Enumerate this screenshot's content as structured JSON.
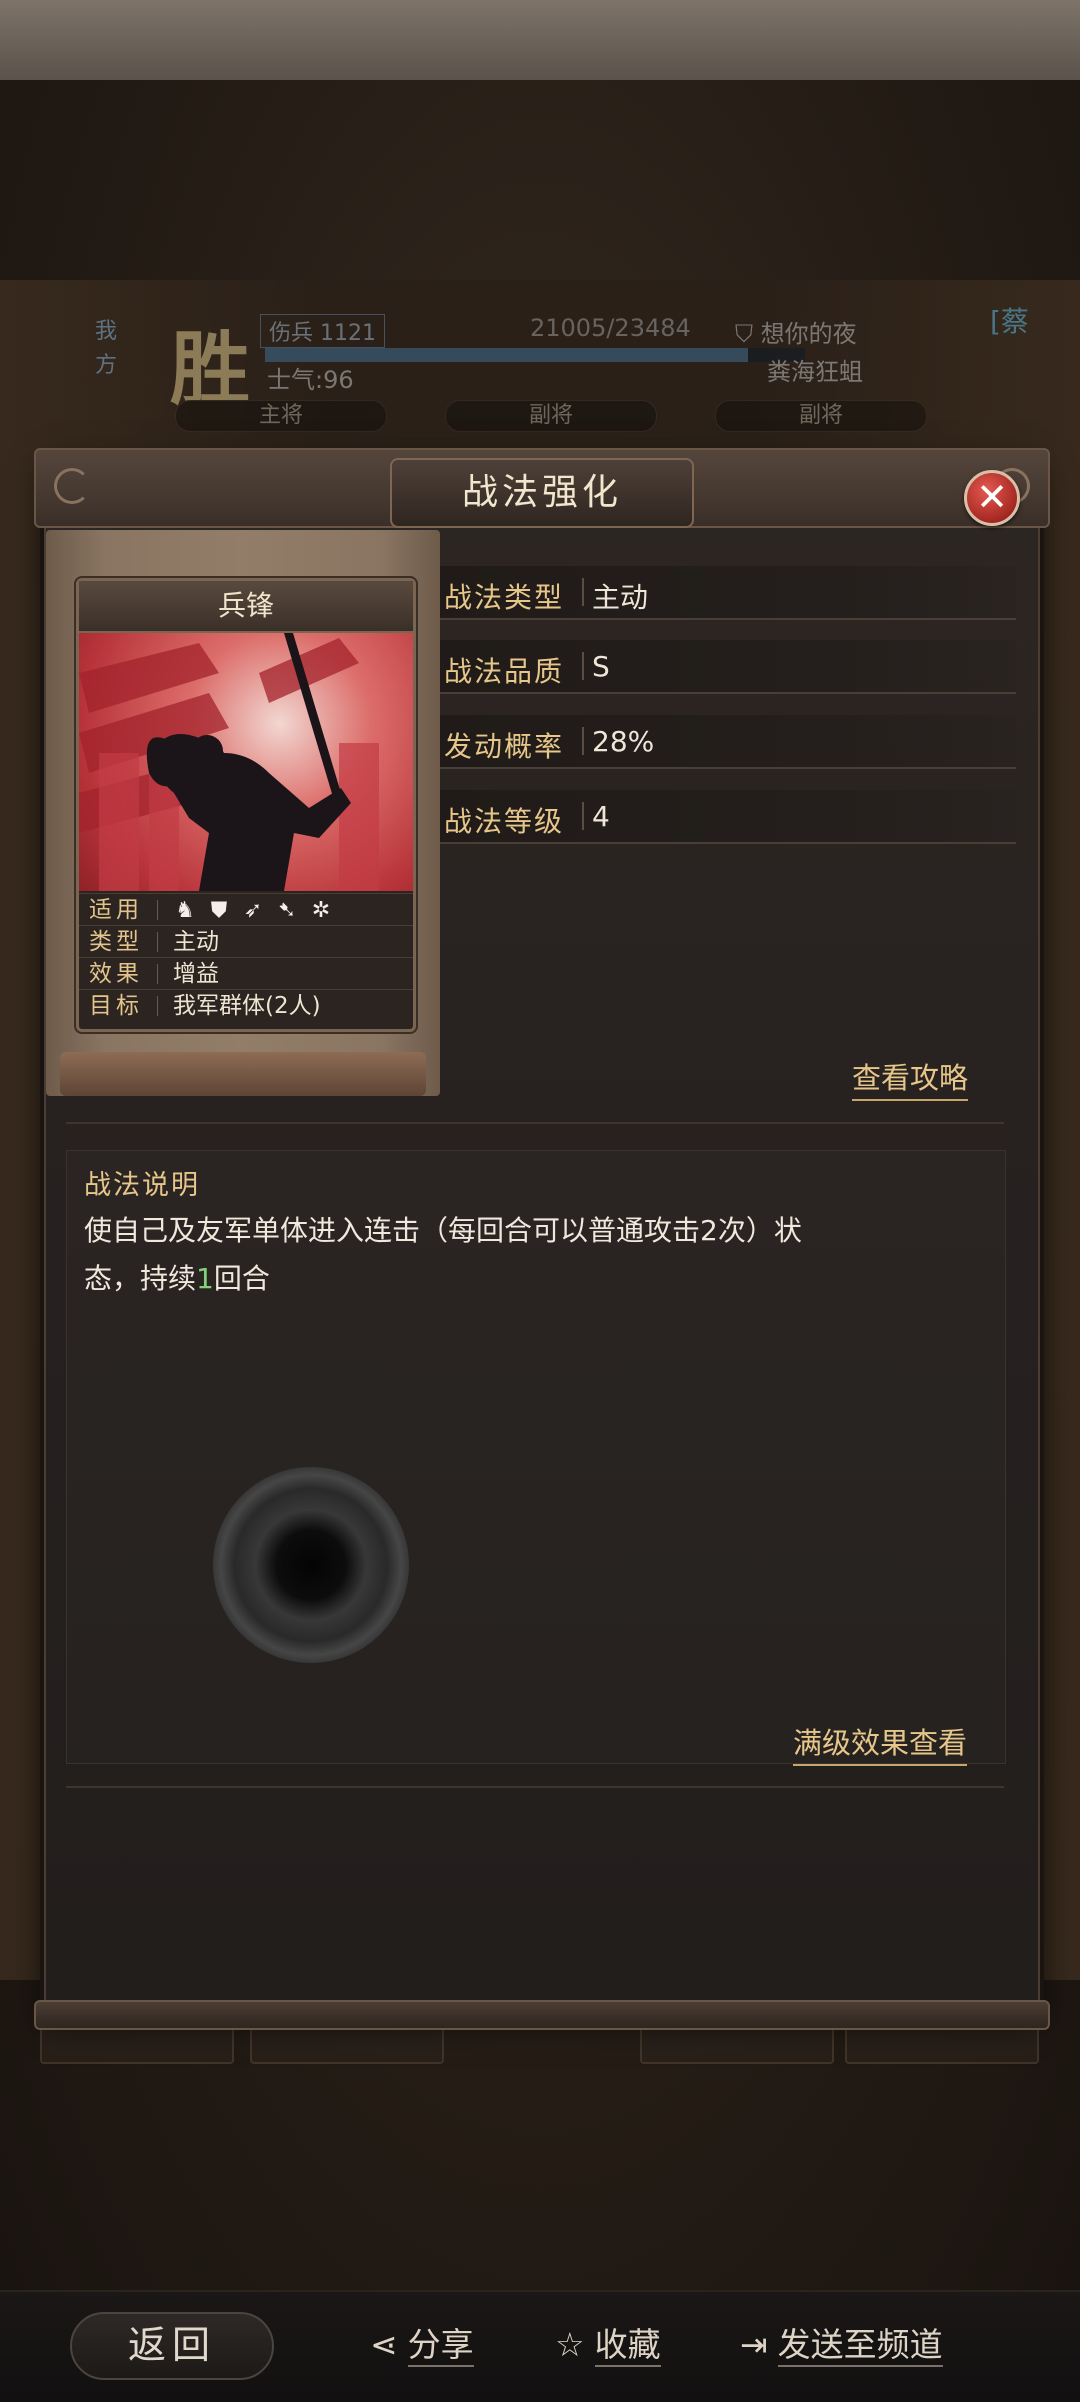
{
  "report": {
    "side_label": "我方",
    "result": "胜",
    "troops": "伤兵 1121",
    "hp": "21005/23484",
    "hp_ratio": 0.894,
    "morale": "士气:96",
    "enemy_name": "想你的夜",
    "enemy_faction": "粪海狂蛆",
    "tag": "[蔡",
    "roles": [
      "主将",
      "副将",
      "副将"
    ]
  },
  "modal": {
    "title": "战法强化",
    "close_symbol": "✕"
  },
  "card": {
    "name": "兵锋",
    "rows": [
      {
        "key": "适用",
        "value": ""
      },
      {
        "key": "类型",
        "value": "主动"
      },
      {
        "key": "效果",
        "value": "增益"
      },
      {
        "key": "目标",
        "value": "我军群体(2人)"
      }
    ],
    "apply_icons": [
      "cavalry-icon",
      "shield-icon",
      "bow-icon",
      "spear-icon",
      "wheel-icon"
    ]
  },
  "info": [
    {
      "key": "战法类型",
      "value": "主动"
    },
    {
      "key": "战法品质",
      "value": "S"
    },
    {
      "key": "发动概率",
      "value": "28%"
    },
    {
      "key": "战法等级",
      "value": "4"
    }
  ],
  "links": {
    "strategy": "查看攻略",
    "max_effect": "满级效果查看"
  },
  "description": {
    "title": "战法说明",
    "line1": "使自己及友军单体进入连击（每回合可以普通攻击2次）状",
    "line2_before": "态，持续",
    "line2_highlight": "1",
    "line2_after": "回合"
  },
  "bottom_nav": {
    "back": "返回",
    "share": "分享",
    "favorite": "收藏",
    "send": "发送至频道"
  }
}
